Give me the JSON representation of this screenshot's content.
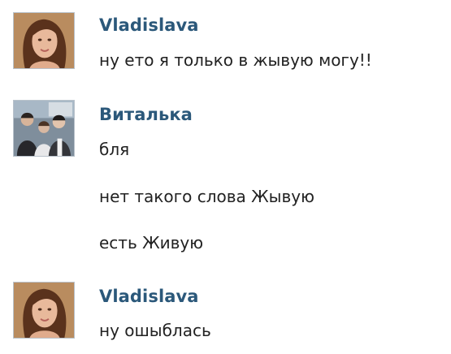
{
  "conversation": {
    "messages": [
      {
        "sender": "Vladislava",
        "avatar_icon": "girl-portrait-avatar-icon",
        "lines": [
          "ну ето я только в жывую могу!!"
        ]
      },
      {
        "sender": "Виталька",
        "avatar_icon": "group-photo-avatar-icon",
        "lines": [
          "бля",
          "нет такого слова Жывую",
          "есть Живую"
        ]
      },
      {
        "sender": "Vladislava",
        "avatar_icon": "girl-portrait-avatar-icon",
        "lines": [
          "ну ошыблась"
        ]
      }
    ]
  },
  "colors": {
    "sender_name": "#2b587a",
    "message_text": "#222222",
    "avatar_border": "#b9c2cb"
  }
}
